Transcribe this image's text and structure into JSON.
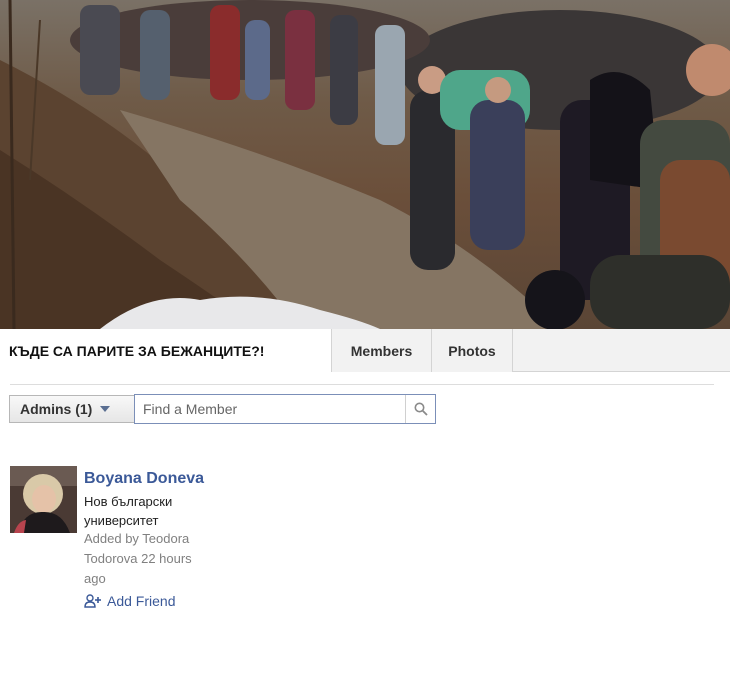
{
  "cover": {
    "icon": "cover-photo"
  },
  "tabs": {
    "group_title": "КЪДЕ СА ПАРИТЕ ЗА БЕЖАНЦИТЕ?!",
    "members": "Members",
    "photos": "Photos"
  },
  "filter": {
    "selected": "Admins (1)",
    "search_placeholder": "Find a Member"
  },
  "member": {
    "name": "Boyana Doneva",
    "info": "Нов български университет",
    "added": "Added by Teodora Todorova 22 hours ago",
    "add_friend": "Add Friend"
  },
  "colors": {
    "link": "#3b5998",
    "muted": "#808080",
    "tab_bg": "#f2f2f2"
  }
}
